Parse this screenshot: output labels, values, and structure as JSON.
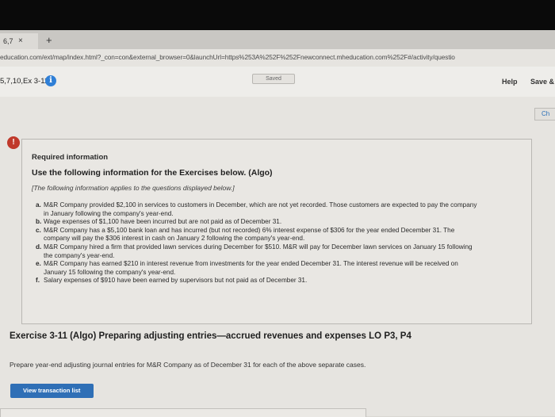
{
  "browser": {
    "tab_title": "6,7",
    "tab_close": "×",
    "new_tab": "+",
    "url": "education.com/ext/map/index.html?_con=con&external_browser=0&launchUrl=https%253A%252F%252Fnewconnect.mheducation.com%252F#/activity/questio"
  },
  "header": {
    "exercise_label": "5,7,10,Ex 3-11",
    "info_icon": "i",
    "saved": "Saved",
    "help": "Help",
    "save_exit": "Save &",
    "check": "Ch"
  },
  "required_info": {
    "badge": "!",
    "title": "Required information",
    "use_line": "Use the following information for the Exercises below. (Algo)",
    "note": "[The following information applies to the questions displayed below.]",
    "items": [
      {
        "letter": "a.",
        "text": "M&R Company provided $2,100 in services to customers in December, which are not yet recorded. Those customers are expected to pay the company in January following the company's year-end."
      },
      {
        "letter": "b.",
        "text": "Wage expenses of $1,100 have been incurred but are not paid as of December 31."
      },
      {
        "letter": "c.",
        "text": "M&R Company has a $5,100 bank loan and has incurred (but not recorded) 6% interest expense of $306 for the year ended December 31. The company will pay the $306 interest in cash on January 2 following the company's year-end."
      },
      {
        "letter": "d.",
        "text": "M&R Company hired a firm that provided lawn services during December for $510. M&R will pay for December lawn services on January 15 following the company's year-end."
      },
      {
        "letter": "e.",
        "text": "M&R Company has earned $210 in interest revenue from investments for the year ended December 31. The interest revenue will be received on January 15 following the company's year-end."
      },
      {
        "letter": "f.",
        "text": "Salary expenses of $910 have been earned by supervisors but not paid as of December 31."
      }
    ]
  },
  "exercise": {
    "title": "Exercise 3-11 (Algo) Preparing adjusting entries—accrued revenues and expenses LO P3, P4",
    "instructions": "Prepare year-end adjusting journal entries for M&R Company as of December 31 for each of the above separate cases.",
    "view_button": "View transaction list"
  }
}
